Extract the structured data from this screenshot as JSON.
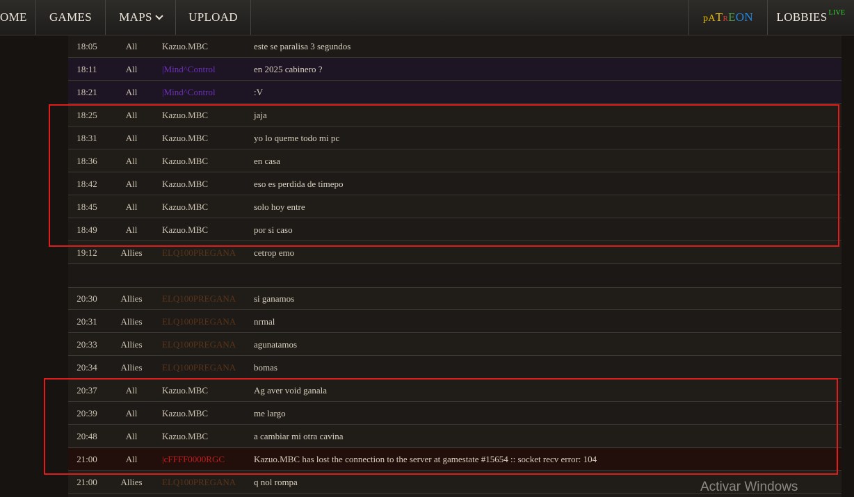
{
  "nav": {
    "home_label": "OME",
    "games_label": "GAMES",
    "maps_label": "MAPS",
    "upload_label": "UPLOAD",
    "patreon_letters": [
      {
        "ch": "p",
        "color": "#e6b800"
      },
      {
        "ch": "A",
        "color": "#e6b800"
      },
      {
        "ch": "T",
        "color": "#e6b800"
      },
      {
        "ch": "R",
        "color": "#e53935"
      },
      {
        "ch": "E",
        "color": "#43a047"
      },
      {
        "ch": "O",
        "color": "#1e88e5"
      },
      {
        "ch": "N",
        "color": "#1e88e5"
      }
    ],
    "lobbies_label": "LOBBIES",
    "live_label": "LIVE"
  },
  "colors": {
    "player_default": "#cfc6b4",
    "player_mind": "#6b2fb8",
    "player_ally": "#5a3418",
    "player_system": "#c21d1d",
    "highlight_box": "#e21b1b"
  },
  "chat": {
    "rows": [
      {
        "time": "18:05",
        "team": "All",
        "player": "Kazuo.MBC",
        "message": "este se paralisa 3 segundos",
        "style": "normal"
      },
      {
        "time": "18:11",
        "team": "All",
        "player": "|Mind^Control",
        "message": "en 2025 cabinero ?",
        "style": "mind"
      },
      {
        "time": "18:21",
        "team": "All",
        "player": "|Mind^Control",
        "message": ":V",
        "style": "mind"
      },
      {
        "time": "18:25",
        "team": "All",
        "player": "Kazuo.MBC",
        "message": "jaja",
        "style": "normal"
      },
      {
        "time": "18:31",
        "team": "All",
        "player": "Kazuo.MBC",
        "message": "yo lo queme todo mi pc",
        "style": "normal"
      },
      {
        "time": "18:36",
        "team": "All",
        "player": "Kazuo.MBC",
        "message": "en casa",
        "style": "normal"
      },
      {
        "time": "18:42",
        "team": "All",
        "player": "Kazuo.MBC",
        "message": "eso es perdida de timepo",
        "style": "normal"
      },
      {
        "time": "18:45",
        "team": "All",
        "player": "Kazuo.MBC",
        "message": "solo hoy entre",
        "style": "normal"
      },
      {
        "time": "18:49",
        "team": "All",
        "player": "Kazuo.MBC",
        "message": "por si caso",
        "style": "normal"
      },
      {
        "time": "19:12",
        "team": "Allies",
        "player": "ELQ100PREGANA",
        "message": "cetrop emo",
        "style": "ally"
      },
      {
        "time": "",
        "team": "",
        "player": "",
        "message": "",
        "style": "blank"
      },
      {
        "time": "20:30",
        "team": "Allies",
        "player": "ELQ100PREGANA",
        "message": "si ganamos",
        "style": "ally"
      },
      {
        "time": "20:31",
        "team": "Allies",
        "player": "ELQ100PREGANA",
        "message": "nrmal",
        "style": "ally"
      },
      {
        "time": "20:33",
        "team": "Allies",
        "player": "ELQ100PREGANA",
        "message": "agunatamos",
        "style": "ally"
      },
      {
        "time": "20:34",
        "team": "Allies",
        "player": "ELQ100PREGANA",
        "message": "bomas",
        "style": "ally"
      },
      {
        "time": "20:37",
        "team": "All",
        "player": "Kazuo.MBC",
        "message": "Ag aver void ganala",
        "style": "normal"
      },
      {
        "time": "20:39",
        "team": "All",
        "player": "Kazuo.MBC",
        "message": "me largo",
        "style": "normal"
      },
      {
        "time": "20:48",
        "team": "All",
        "player": "Kazuo.MBC",
        "message": "a cambiar mi otra cavina",
        "style": "normal"
      },
      {
        "time": "21:00",
        "team": "All",
        "player": "|cFFFF0000RGC",
        "message": "Kazuo.MBC has lost the connection to the server at gamestate #15654 :: socket recv error: 104",
        "style": "error"
      },
      {
        "time": "21:00",
        "team": "Allies",
        "player": "ELQ100PREGANA",
        "message": "q nol rompa",
        "style": "ally"
      }
    ]
  },
  "watermark": "Activar Windows"
}
